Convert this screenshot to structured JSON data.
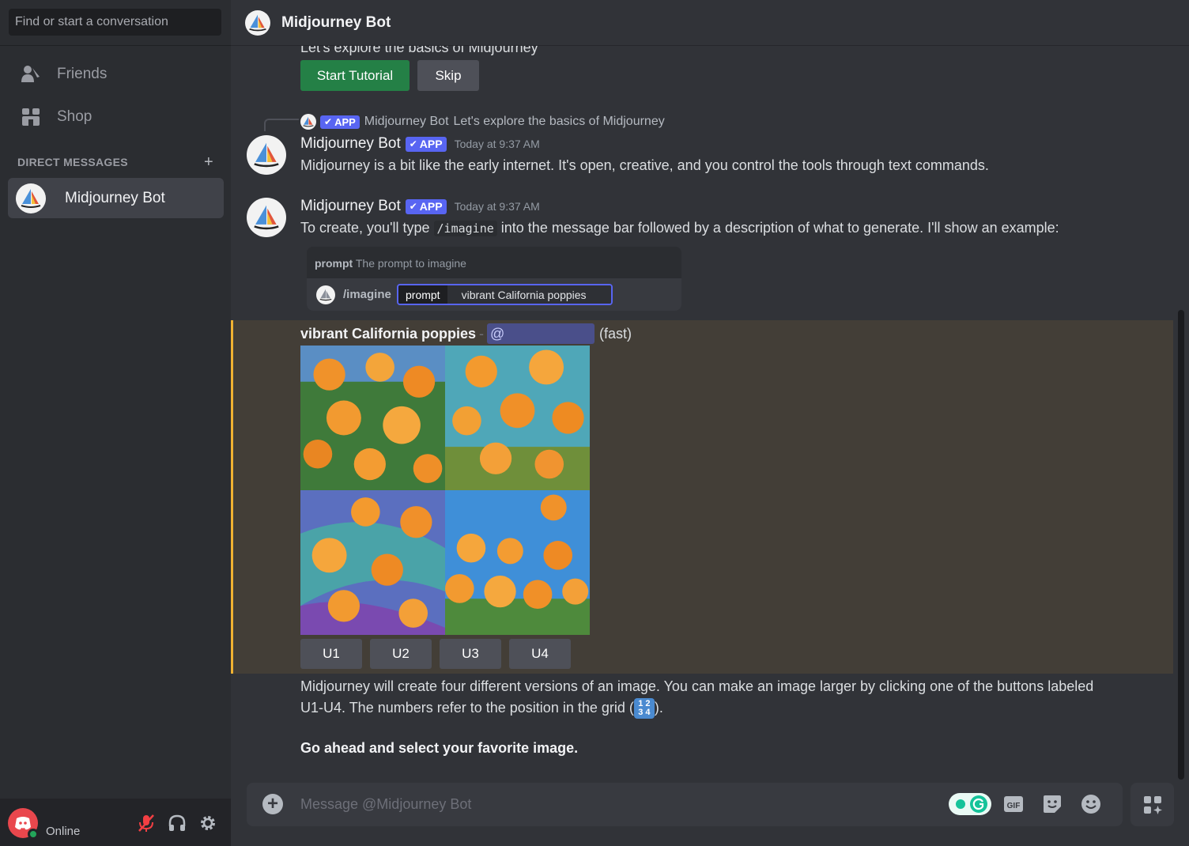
{
  "sidebar": {
    "search_placeholder": "Find or start a conversation",
    "nav": [
      {
        "label": "Friends"
      },
      {
        "label": "Shop"
      }
    ],
    "dm_header": "DIRECT MESSAGES",
    "dm_add": "+",
    "dms": [
      {
        "label": "Midjourney Bot"
      }
    ],
    "user_status": "Online"
  },
  "header": {
    "title": "Midjourney Bot"
  },
  "messages": {
    "intro_text": "Let's explore the basics of Midjourney",
    "start_tutorial": "Start Tutorial",
    "skip": "Skip",
    "reply_ref": {
      "app_tag": "APP",
      "author": "Midjourney Bot",
      "text": "Let's explore the basics of Midjourney"
    },
    "msg1": {
      "author": "Midjourney Bot",
      "app_tag": "APP",
      "time": "Today at 9:37 AM",
      "text": "Midjourney is a bit like the early internet. It's open, creative, and you control the tools through text commands."
    },
    "msg2": {
      "author": "Midjourney Bot",
      "app_tag": "APP",
      "time": "Today at 9:37 AM",
      "text_before": "To create, you'll type ",
      "code": "/imagine",
      "text_after": " into the message bar followed by a description of what to generate. I'll show an example:",
      "example": {
        "hint_key": "prompt",
        "hint_text": "The prompt to imagine",
        "command": "/imagine",
        "param_key": "prompt",
        "param_value": "vibrant California poppies"
      }
    },
    "generation": {
      "prompt": "vibrant California poppies",
      "separator": "-",
      "mention": "@",
      "speed": "(fast)",
      "upscale_buttons": [
        "U1",
        "U2",
        "U3",
        "U4"
      ]
    },
    "explain_line1": "Midjourney will create four different versions of an image. You can make an image larger by clicking one of the buttons labeled",
    "explain_line2_before": "U1-U4. The numbers refer to the position in the grid (",
    "grid_badge_top": "1 2",
    "grid_badge_bottom": "3 4",
    "explain_line2_after": ").",
    "cta": "Go ahead and select your favorite image."
  },
  "composer": {
    "placeholder": "Message @Midjourney Bot"
  },
  "colors": {
    "blurple": "#5865f2",
    "green": "#248046",
    "highlight_border": "#f0b232",
    "online": "#23a55a"
  },
  "icons": [
    "friends-icon",
    "shop-icon",
    "sailboat-icon",
    "mute-icon",
    "headphones-icon",
    "gear-icon",
    "discord-icon",
    "add-icon",
    "grammarly-icon",
    "gif-icon",
    "sticker-icon",
    "emoji-icon",
    "apps-icon"
  ]
}
